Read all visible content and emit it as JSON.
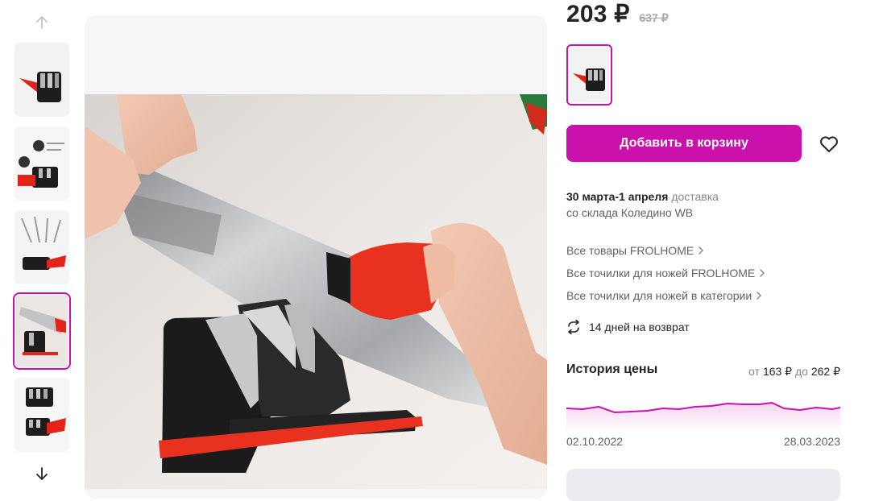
{
  "gallery": {
    "up_icon": "arrow-up-icon",
    "down_icon": "arrow-down-icon",
    "active_index": 3
  },
  "product": {
    "price_current": "203 ₽",
    "price_old": "637 ₽"
  },
  "actions": {
    "add_to_cart_label": "Добавить в корзину",
    "favorite_icon": "heart-icon"
  },
  "delivery": {
    "date": "30 марта-1 апреля",
    "label": "доставка",
    "source": "со склада Коледино WB"
  },
  "links": [
    {
      "label": "Все товары FROLHOME"
    },
    {
      "label": "Все точилки для ножей FROLHOME"
    },
    {
      "label": "Все точилки для ножей в категории"
    }
  ],
  "return_policy": {
    "label": "14 дней на возврат",
    "icon": "return-arrows-icon"
  },
  "price_history": {
    "title": "История цены",
    "from_word": "от",
    "min_price": "163 ₽",
    "to_word": "до",
    "max_price": "262 ₽",
    "start_date": "02.10.2022",
    "end_date": "28.03.2023"
  },
  "colors": {
    "accent": "#cb11ab",
    "text": "#242424",
    "muted": "#868695",
    "old_price": "#a7a7a7",
    "blade_red": "#e8321f"
  }
}
